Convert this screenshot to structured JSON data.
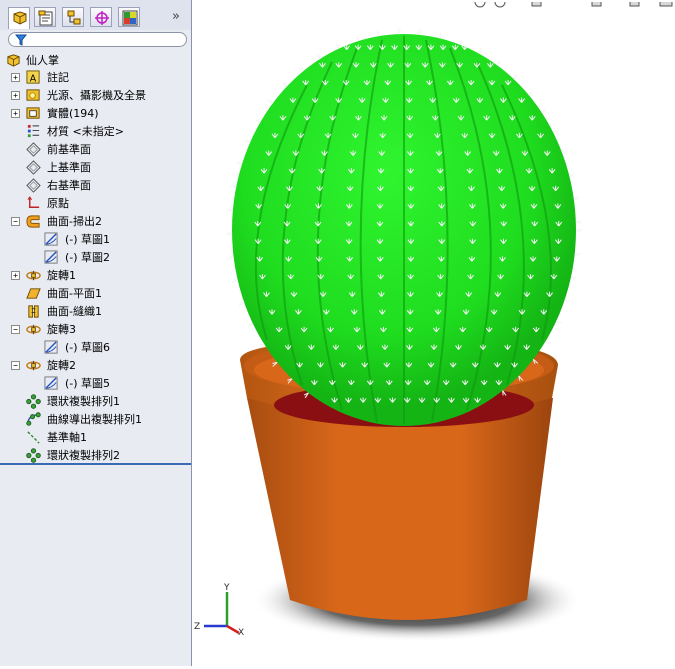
{
  "feature_tree": {
    "root_label": "仙人掌",
    "items": [
      {
        "label": "註記",
        "icon": "annotation-icon",
        "expander": "+",
        "indent": 0
      },
      {
        "label": "光源、攝影機及全景",
        "icon": "lights-cameras-icon",
        "expander": "+",
        "indent": 0
      },
      {
        "label": "實體(194)",
        "icon": "solid-bodies-icon",
        "expander": "+",
        "indent": 0
      },
      {
        "label": "材質 <未指定>",
        "icon": "material-icon",
        "expander": "",
        "indent": 0
      },
      {
        "label": "前基準面",
        "icon": "plane-icon",
        "expander": "",
        "indent": 0
      },
      {
        "label": "上基準面",
        "icon": "plane-icon",
        "expander": "",
        "indent": 0
      },
      {
        "label": "右基準面",
        "icon": "plane-icon",
        "expander": "",
        "indent": 0
      },
      {
        "label": "原點",
        "icon": "origin-icon",
        "expander": "",
        "indent": 0
      },
      {
        "label": "曲面-掃出2",
        "icon": "surface-sweep-icon",
        "expander": "−",
        "indent": 0
      },
      {
        "label": "(-) 草圖1",
        "icon": "sketch-icon",
        "expander": "",
        "indent": 1
      },
      {
        "label": "(-) 草圖2",
        "icon": "sketch-icon",
        "expander": "",
        "indent": 1
      },
      {
        "label": "旋轉1",
        "icon": "revolve-icon",
        "expander": "+",
        "indent": 0
      },
      {
        "label": "曲面-平面1",
        "icon": "planar-surface-icon",
        "expander": "",
        "indent": 0
      },
      {
        "label": "曲面-縫織1",
        "icon": "knit-surface-icon",
        "expander": "",
        "indent": 0
      },
      {
        "label": "旋轉3",
        "icon": "revolve-icon",
        "expander": "−",
        "indent": 0
      },
      {
        "label": "(-) 草圖6",
        "icon": "sketch-icon",
        "expander": "",
        "indent": 1
      },
      {
        "label": "旋轉2",
        "icon": "revolve-icon",
        "expander": "−",
        "indent": 0
      },
      {
        "label": "(-) 草圖5",
        "icon": "sketch-icon",
        "expander": "",
        "indent": 1
      },
      {
        "label": "環狀複製排列1",
        "icon": "circular-pattern-icon",
        "expander": "",
        "indent": 0
      },
      {
        "label": "曲線導出複製排列1",
        "icon": "curve-pattern-icon",
        "expander": "",
        "indent": 0
      },
      {
        "label": "基準軸1",
        "icon": "axis-icon",
        "expander": "",
        "indent": 0
      },
      {
        "label": "環狀複製排列2",
        "icon": "circular-pattern-icon",
        "expander": "",
        "indent": 0
      }
    ]
  },
  "tabs": [
    {
      "name": "feature-manager-tab",
      "icon": "feature-manager-icon"
    },
    {
      "name": "property-manager-tab",
      "icon": "property-manager-icon"
    },
    {
      "name": "configuration-manager-tab",
      "icon": "configuration-manager-icon"
    },
    {
      "name": "dimxpert-tab",
      "icon": "dimxpert-icon"
    },
    {
      "name": "display-manager-tab",
      "icon": "display-manager-icon"
    }
  ],
  "more_tabs": "»",
  "triad": {
    "x": "X",
    "y": "Y",
    "z": "Z"
  },
  "colors": {
    "cactus": "#1fdc1f",
    "pot": "#d8671a",
    "soil": "#8a0f12",
    "panel_bg": "#e9ebf3"
  }
}
